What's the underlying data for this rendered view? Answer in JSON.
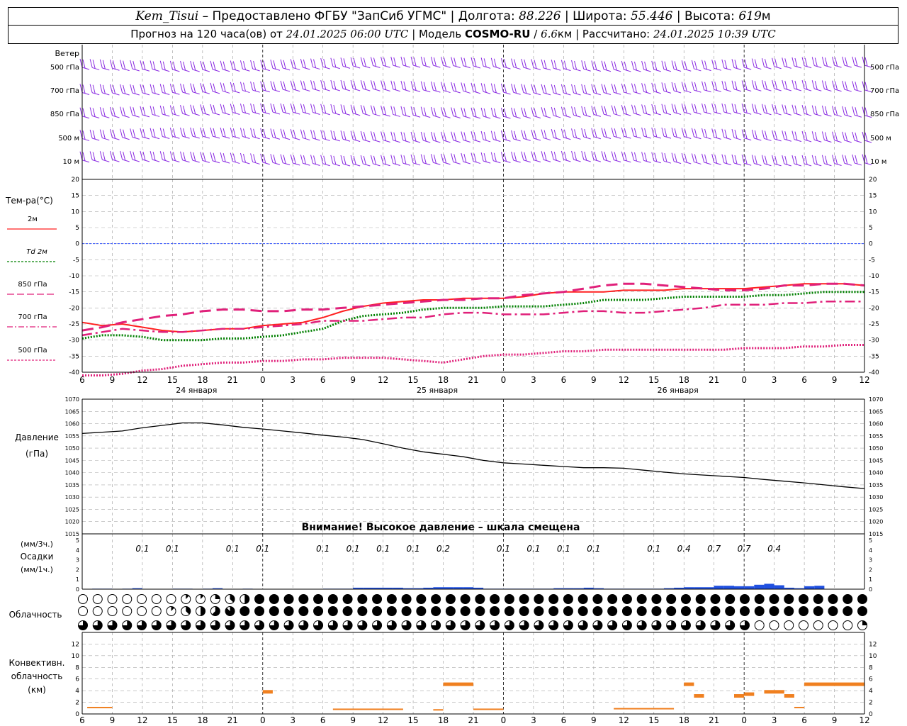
{
  "header": {
    "station": "Kem_Tisui",
    "provider": "Предоставлено ФГБУ \"ЗапСиб УГМС\"",
    "lon_label": "Долгота:",
    "lon_value": "88.226",
    "lat_label": "Широта:",
    "lat_value": "55.446",
    "alt_label": "Высота:",
    "alt_value": "619",
    "alt_unit": "м",
    "forecast_label": "Прогноз на 120 часа(ов) от",
    "forecast_time": "24.01.2025 06:00 UTC",
    "model_label": "Модель",
    "model_name": "COSMO-RU",
    "model_res": "6.6",
    "model_res_unit": "км",
    "calc_label": "Рассчитано:",
    "calc_time": "24.01.2025 10:39 UTC"
  },
  "wind_panel": {
    "title": "Ветер",
    "levels": [
      "500 гПа",
      "700 гПа",
      "850 гПа",
      "500 м",
      "10  м"
    ],
    "color": "#8a2be2"
  },
  "temp_panel": {
    "title": "Тем-ра(°С)",
    "legend": [
      {
        "label": "2м",
        "color": "#ff2020",
        "style": "solid"
      },
      {
        "label": "Td  2м",
        "color": "#008000",
        "style": "dotted"
      },
      {
        "label": "850 гПа",
        "color": "#e0207a",
        "style": "longdash"
      },
      {
        "label": "700 гПа",
        "color": "#e0207a",
        "style": "dashdot"
      },
      {
        "label": "500 гПа",
        "color": "#e0207a",
        "style": "dotted"
      }
    ]
  },
  "pressure_panel": {
    "title": "Давление",
    "unit": "(гПа)",
    "warning": "Внимание! Высокое давление – шкала смещена"
  },
  "precip_panel": {
    "unit_3h": "(мм/3ч.)",
    "title": "Осадки",
    "unit_1h": "(мм/1ч.)",
    "labels": [
      {
        "h": 8,
        "v": "0.1"
      },
      {
        "h": 11,
        "v": "0.1"
      },
      {
        "h": 17,
        "v": "0.1"
      },
      {
        "h": 20,
        "v": "0.1"
      },
      {
        "h": 26,
        "v": "0.1"
      },
      {
        "h": 29,
        "v": "0.1"
      },
      {
        "h": 32,
        "v": "0.1"
      },
      {
        "h": 35,
        "v": "0.1"
      },
      {
        "h": 38,
        "v": "0.2"
      },
      {
        "h": 44,
        "v": "0.1"
      },
      {
        "h": 47,
        "v": "0.1"
      },
      {
        "h": 50,
        "v": "0.1"
      },
      {
        "h": 53,
        "v": "0.1"
      },
      {
        "h": 59,
        "v": "0.1"
      },
      {
        "h": 62,
        "v": "0.4"
      },
      {
        "h": 65,
        "v": "0.7"
      },
      {
        "h": 68,
        "v": "0.7"
      },
      {
        "h": 71,
        "v": "0.4"
      }
    ]
  },
  "cloud_panel": {
    "title": "Облачность"
  },
  "conv_panel": {
    "title_1": "Конвективн.",
    "title_2": "облачность",
    "unit": "(км)"
  },
  "time_axis": {
    "ticks": [
      "6",
      "9",
      "12",
      "15",
      "18",
      "21",
      "0",
      "3",
      "6",
      "9",
      "12",
      "15",
      "18",
      "21",
      "0",
      "3",
      "6",
      "9",
      "12",
      "15",
      "18",
      "21",
      "0",
      "3",
      "6",
      "9",
      "12"
    ],
    "day_labels": [
      {
        "h": 11.4,
        "text": "24 января"
      },
      {
        "h": 35.4,
        "text": "25 января"
      },
      {
        "h": 59.4,
        "text": "26 января"
      }
    ]
  },
  "chart_data": [
    {
      "type": "line",
      "title": "Тем-ра(°С)",
      "x_hours_from_06utc_24jan": [
        0,
        2,
        4,
        6,
        8,
        10,
        12,
        14,
        16,
        18,
        20,
        22,
        24,
        26,
        28,
        30,
        32,
        34,
        36,
        38,
        40,
        42,
        44,
        46,
        48,
        50,
        52,
        54,
        56,
        58,
        60,
        62,
        64,
        66,
        68,
        70,
        72,
        74,
        76,
        78
      ],
      "ylim": [
        -40,
        20
      ],
      "yticks": [
        20,
        15,
        10,
        5,
        0,
        -5,
        -10,
        -15,
        -20,
        -25,
        -30,
        -35,
        -40
      ],
      "series": [
        {
          "name": "2м",
          "values": [
            -24.5,
            -25.5,
            -25,
            -26,
            -27,
            -27.5,
            -27,
            -26.5,
            -26.5,
            -25.5,
            -25,
            -24.5,
            -23,
            -21,
            -19.5,
            -18.5,
            -18,
            -17.5,
            -17.5,
            -17,
            -17,
            -17,
            -16.5,
            -15.5,
            -15,
            -15,
            -15,
            -14.5,
            -14.5,
            -14.5,
            -14,
            -14,
            -14,
            -14,
            -13.5,
            -13,
            -12.5,
            -12.5,
            -12.5,
            -13
          ]
        },
        {
          "name": "Td  2м",
          "values": [
            -29.5,
            -28.5,
            -28.5,
            -29,
            -30,
            -30,
            -30,
            -29.5,
            -29.5,
            -29,
            -28.5,
            -27.5,
            -26.5,
            -24,
            -22.5,
            -22,
            -21.5,
            -20.5,
            -20,
            -20,
            -20,
            -19.5,
            -19.5,
            -19.5,
            -19,
            -18.5,
            -17.5,
            -17.5,
            -17.5,
            -17,
            -16.5,
            -16.5,
            -16.5,
            -16.5,
            -16,
            -16,
            -15.5,
            -15,
            -15,
            -15
          ]
        },
        {
          "name": "850 гПа",
          "values": [
            -27,
            -26,
            -24.5,
            -23.5,
            -22.5,
            -22,
            -21,
            -20.5,
            -20.5,
            -21,
            -21,
            -20.5,
            -20.5,
            -20,
            -19.5,
            -19,
            -18.5,
            -18,
            -17.5,
            -17.5,
            -17,
            -17,
            -16,
            -15.5,
            -15,
            -14,
            -13,
            -12.5,
            -12.5,
            -13,
            -13.5,
            -14,
            -14.5,
            -14.5,
            -14,
            -13,
            -13,
            -12.5,
            -12.5,
            -13
          ]
        },
        {
          "name": "700 гПа",
          "values": [
            -28.5,
            -27.5,
            -26.5,
            -27,
            -27.5,
            -27.5,
            -27,
            -26.5,
            -26.5,
            -26,
            -25.5,
            -25,
            -24,
            -24,
            -24,
            -23.5,
            -23,
            -23,
            -22,
            -21.5,
            -21.5,
            -22,
            -22,
            -22,
            -21.5,
            -21,
            -21,
            -21.5,
            -21.5,
            -21,
            -20.5,
            -20,
            -19,
            -19,
            -19,
            -18.5,
            -18.5,
            -18,
            -18,
            -18
          ]
        },
        {
          "name": "500 гПа",
          "values": [
            -42,
            -41,
            -40.5,
            -39.5,
            -39,
            -38,
            -37.5,
            -37,
            -37,
            -36.5,
            -36.5,
            -36,
            -36,
            -35.5,
            -35.5,
            -35.5,
            -36,
            -36.5,
            -37,
            -36,
            -35,
            -34.5,
            -34.5,
            -34,
            -33.5,
            -33.5,
            -33,
            -33,
            -33,
            -33,
            -33,
            -33,
            -33,
            -32.5,
            -32.5,
            -32.5,
            -32,
            -32,
            -31.5,
            -31.5
          ]
        }
      ]
    },
    {
      "type": "line",
      "title": "Давление",
      "ylabel": "(гПа)",
      "x_hours_from_06utc_24jan": [
        0,
        2,
        4,
        6,
        8,
        10,
        12,
        14,
        16,
        18,
        20,
        22,
        24,
        26,
        28,
        30,
        32,
        34,
        36,
        38,
        40,
        42,
        44,
        46,
        48,
        50,
        52,
        54,
        56,
        58,
        60,
        62,
        64,
        66,
        68,
        70,
        72,
        74,
        76,
        78
      ],
      "ylim": [
        1015,
        1070
      ],
      "yticks": [
        1070,
        1065,
        1060,
        1055,
        1050,
        1045,
        1040,
        1035,
        1030,
        1025,
        1020,
        1015
      ],
      "series": [
        {
          "name": "Давление",
          "values": [
            1056,
            1056.5,
            1057,
            1058.3,
            1059.3,
            1060.3,
            1060.3,
            1059.5,
            1058.5,
            1057.8,
            1057,
            1056.2,
            1055.3,
            1054.5,
            1053.5,
            1051.8,
            1050,
            1048.5,
            1047.5,
            1046.5,
            1045,
            1044,
            1043.5,
            1043,
            1042.5,
            1042,
            1042,
            1041.8,
            1041,
            1040.2,
            1039.5,
            1039,
            1038.5,
            1038,
            1037.2,
            1036.5,
            1035.8,
            1035,
            1034.2,
            1033.5
          ]
        }
      ]
    },
    {
      "type": "bar",
      "title": "Осадки",
      "ylabel": "(мм/1ч.)",
      "ylim": [
        0,
        5
      ],
      "yticks": [
        5,
        4,
        3,
        2,
        1,
        0
      ],
      "x_hours_from_06utc_24jan": [
        0,
        1,
        2,
        3,
        4,
        5,
        6,
        7,
        8,
        9,
        10,
        11,
        12,
        13,
        14,
        15,
        16,
        17,
        18,
        19,
        20,
        21,
        22,
        23,
        24,
        25,
        26,
        27,
        28,
        29,
        30,
        31,
        32,
        33,
        34,
        35,
        36,
        37,
        38,
        39,
        40,
        41,
        42,
        43,
        44,
        45,
        46,
        47,
        48,
        49,
        50,
        51,
        52,
        53,
        54,
        55,
        56,
        57,
        58,
        59,
        60,
        61,
        62,
        63,
        64,
        65,
        66,
        67,
        68,
        69,
        70,
        71,
        72,
        73,
        74,
        75,
        76,
        77,
        78
      ],
      "values": [
        0,
        0.05,
        0.05,
        0,
        0.05,
        0.1,
        0,
        0,
        0,
        0.05,
        0.05,
        0,
        0.05,
        0.1,
        0,
        0,
        0.05,
        0,
        0,
        0,
        0,
        0,
        0,
        0,
        0.05,
        0.05,
        0.05,
        0.15,
        0.15,
        0.15,
        0.15,
        0.15,
        0.1,
        0.1,
        0.15,
        0.2,
        0.2,
        0.2,
        0.2,
        0.15,
        0.05,
        0.05,
        0.05,
        0.05,
        0.05,
        0.05,
        0.05,
        0.1,
        0.1,
        0.1,
        0.15,
        0.1,
        0.05,
        0.05,
        0.05,
        0.05,
        0.05,
        0.05,
        0.1,
        0.15,
        0.2,
        0.2,
        0.2,
        0.35,
        0.35,
        0.3,
        0.3,
        0.45,
        0.55,
        0.4,
        0.15,
        0.1,
        0.3,
        0.35,
        0,
        0,
        0,
        0,
        0
      ],
      "series_name": "мм/1ч"
    },
    {
      "type": "table",
      "title": "Облачность",
      "rows_note": "three rows of 3-hourly cloud cover symbols (oktas 0..8)",
      "x_step_hours": 1,
      "row_top": [
        0,
        0,
        0,
        0,
        0,
        0,
        0,
        0,
        0,
        0,
        1,
        1,
        1,
        2,
        3,
        3,
        4,
        6,
        8,
        8,
        8,
        8,
        8,
        8,
        8,
        8,
        8,
        8,
        8,
        8,
        8,
        8,
        8,
        8,
        8,
        8,
        8,
        8,
        8,
        8,
        8,
        8,
        8,
        8,
        8,
        8,
        8,
        8,
        8,
        8,
        8,
        8,
        8,
        8,
        8,
        8,
        8,
        8,
        8,
        8,
        8,
        8,
        8,
        8,
        8,
        8,
        8,
        8,
        8,
        8,
        8,
        8,
        8,
        8,
        8,
        8,
        8,
        8,
        8,
        8
      ],
      "row_middle": [
        0,
        0,
        0,
        0,
        0,
        0,
        0,
        0,
        0,
        1,
        3,
        4,
        4,
        5,
        6,
        7,
        8,
        8,
        8,
        8,
        8,
        8,
        8,
        8,
        8,
        8,
        8,
        8,
        8,
        8,
        8,
        8,
        8,
        8,
        8,
        8,
        8,
        8,
        8,
        8,
        8,
        8,
        8,
        8,
        8,
        8,
        8,
        8,
        8,
        8,
        8,
        8,
        8,
        8,
        8,
        8,
        8,
        8,
        8,
        8,
        8,
        8,
        8,
        8,
        8,
        8,
        8,
        8,
        8,
        8,
        8,
        8,
        8,
        8,
        8,
        8,
        8,
        8,
        8,
        8
      ],
      "row_bottom": [
        6,
        6,
        6,
        6,
        6,
        6,
        6,
        6,
        6,
        6,
        6,
        6,
        6,
        6,
        6,
        6,
        6,
        6,
        6,
        6,
        6,
        6,
        6,
        6,
        6,
        6,
        6,
        6,
        6,
        6,
        6,
        6,
        6,
        6,
        6,
        6,
        6,
        6,
        6,
        6,
        6,
        6,
        6,
        6,
        6,
        6,
        6,
        6,
        6,
        6,
        6,
        6,
        6,
        6,
        6,
        6,
        6,
        6,
        6,
        6,
        6,
        6,
        6,
        6,
        6,
        6,
        6,
        6,
        6,
        0,
        0,
        0,
        0,
        0,
        0,
        0,
        0,
        0,
        0,
        2
      ]
    },
    {
      "type": "bar",
      "title": "Конвективн. облачность",
      "ylabel": "(км)",
      "ylim": [
        0,
        14
      ],
      "yticks": [
        12,
        10,
        8,
        6,
        4,
        2,
        0
      ],
      "segments_note": "horizontal bars: [start_hour, end_hour, height_km]",
      "segments": [
        [
          0.5,
          3,
          1.1
        ],
        [
          18,
          19,
          3.8
        ],
        [
          25,
          32,
          0.8
        ],
        [
          35,
          36,
          0.7
        ],
        [
          36,
          39,
          5.1
        ],
        [
          39,
          42,
          0.8
        ],
        [
          53,
          59,
          0.9
        ],
        [
          60,
          61,
          5.1
        ],
        [
          61,
          62,
          3.1
        ],
        [
          65,
          66,
          3.1
        ],
        [
          66,
          67,
          3.4
        ],
        [
          68,
          70,
          3.8
        ],
        [
          70,
          71,
          3.1
        ],
        [
          71,
          72,
          1.1
        ],
        [
          72,
          80,
          5.1
        ]
      ]
    }
  ],
  "colors": {
    "wind": "#8a2be2",
    "t2m": "#ff2020",
    "td2m": "#008000",
    "upper": "#e0207a",
    "zero_line": "#3050ff",
    "pressure": "#000000",
    "precip": "#2050e0",
    "conv": "#f08020"
  }
}
